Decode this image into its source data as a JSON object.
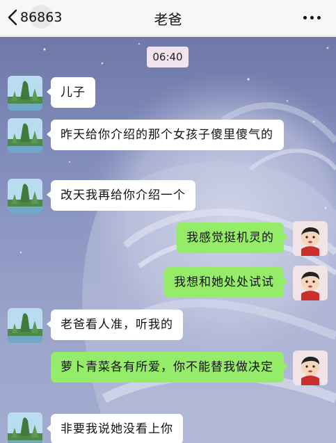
{
  "header": {
    "back_count": "86863",
    "title": "老爸",
    "back_icon": "chevron-left-icon",
    "more_icon": "more-dots-icon"
  },
  "chat": {
    "timestamp": "06:40",
    "messages": [
      {
        "side": "left",
        "text": "儿子"
      },
      {
        "side": "left",
        "text": "昨天给你介绍的那个女孩子傻里傻气的"
      },
      {
        "side": "left",
        "text": "改天我再给你介绍一个"
      },
      {
        "side": "right",
        "text": "我感觉挺机灵的"
      },
      {
        "side": "right",
        "text": "我想和她处处试试"
      },
      {
        "side": "left",
        "text": "老爸看人准，听我的"
      },
      {
        "side": "right",
        "text": "萝卜青菜各有所爱，你不能替我做决定"
      },
      {
        "side": "left",
        "text": "非要我说她没看上你"
      }
    ]
  },
  "colors": {
    "bubble_left": "#ffffff",
    "bubble_right": "#95ec69",
    "timestamp_bg": "#f1e4ee",
    "chat_bg": "#7b86b5"
  }
}
